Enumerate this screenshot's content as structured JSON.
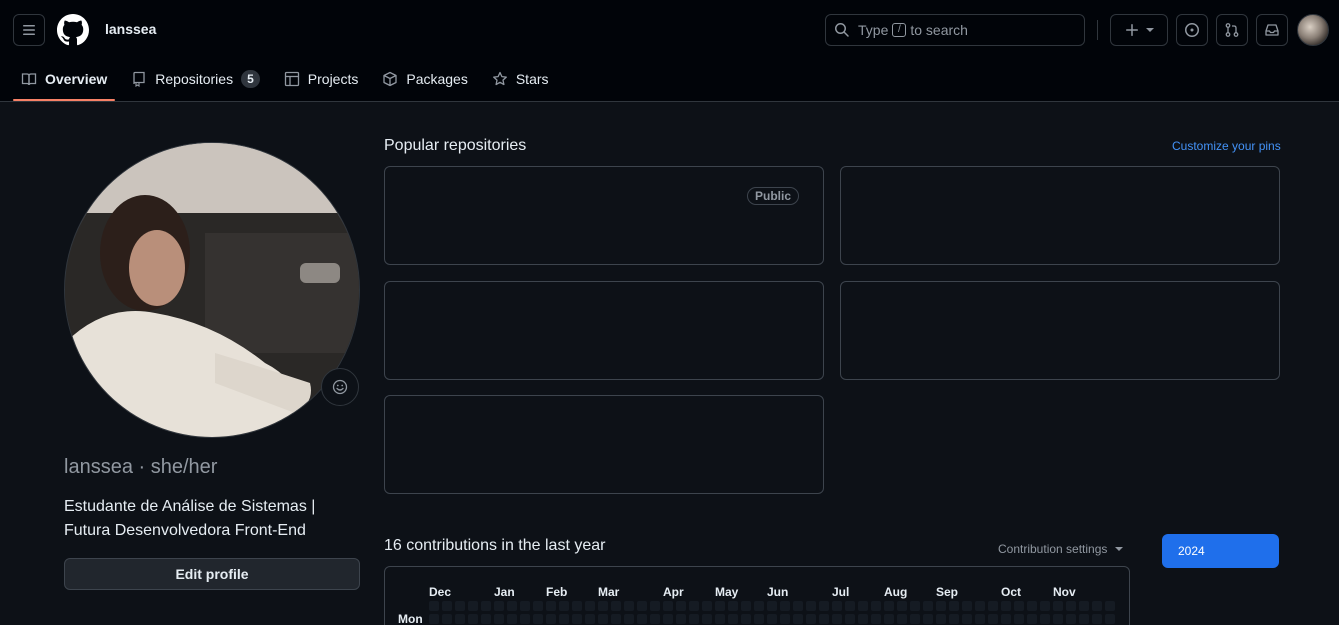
{
  "header": {
    "context_name": "lanssea",
    "search": {
      "prefix": "Type",
      "key": "/",
      "suffix": "to search"
    }
  },
  "tabs": [
    {
      "label": "Overview",
      "icon": "book-icon",
      "active": true
    },
    {
      "label": "Repositories",
      "icon": "repo-icon",
      "count": "5"
    },
    {
      "label": "Projects",
      "icon": "table-icon"
    },
    {
      "label": "Packages",
      "icon": "package-icon"
    },
    {
      "label": "Stars",
      "icon": "star-icon"
    }
  ],
  "profile": {
    "username_line": "lanssea · she/her",
    "bio": "Estudante de Análise de Sistemas | Futura Desenvolvedora Front-End",
    "edit_label": "Edit profile"
  },
  "popular": {
    "title": "Popular repositories",
    "customize": "Customize your pins",
    "public_badge": "Public"
  },
  "contributions": {
    "title": "16 contributions in the last year",
    "settings": "Contribution settings",
    "year": "2024",
    "months": [
      "Dec",
      "Jan",
      "Feb",
      "Mar",
      "Apr",
      "May",
      "Jun",
      "Jul",
      "Aug",
      "Sep",
      "Oct",
      "Nov"
    ],
    "day_label": "Mon"
  },
  "colors": {
    "accent": "#1f6feb",
    "tab_underline": "#f78166",
    "link": "#4493f8"
  }
}
